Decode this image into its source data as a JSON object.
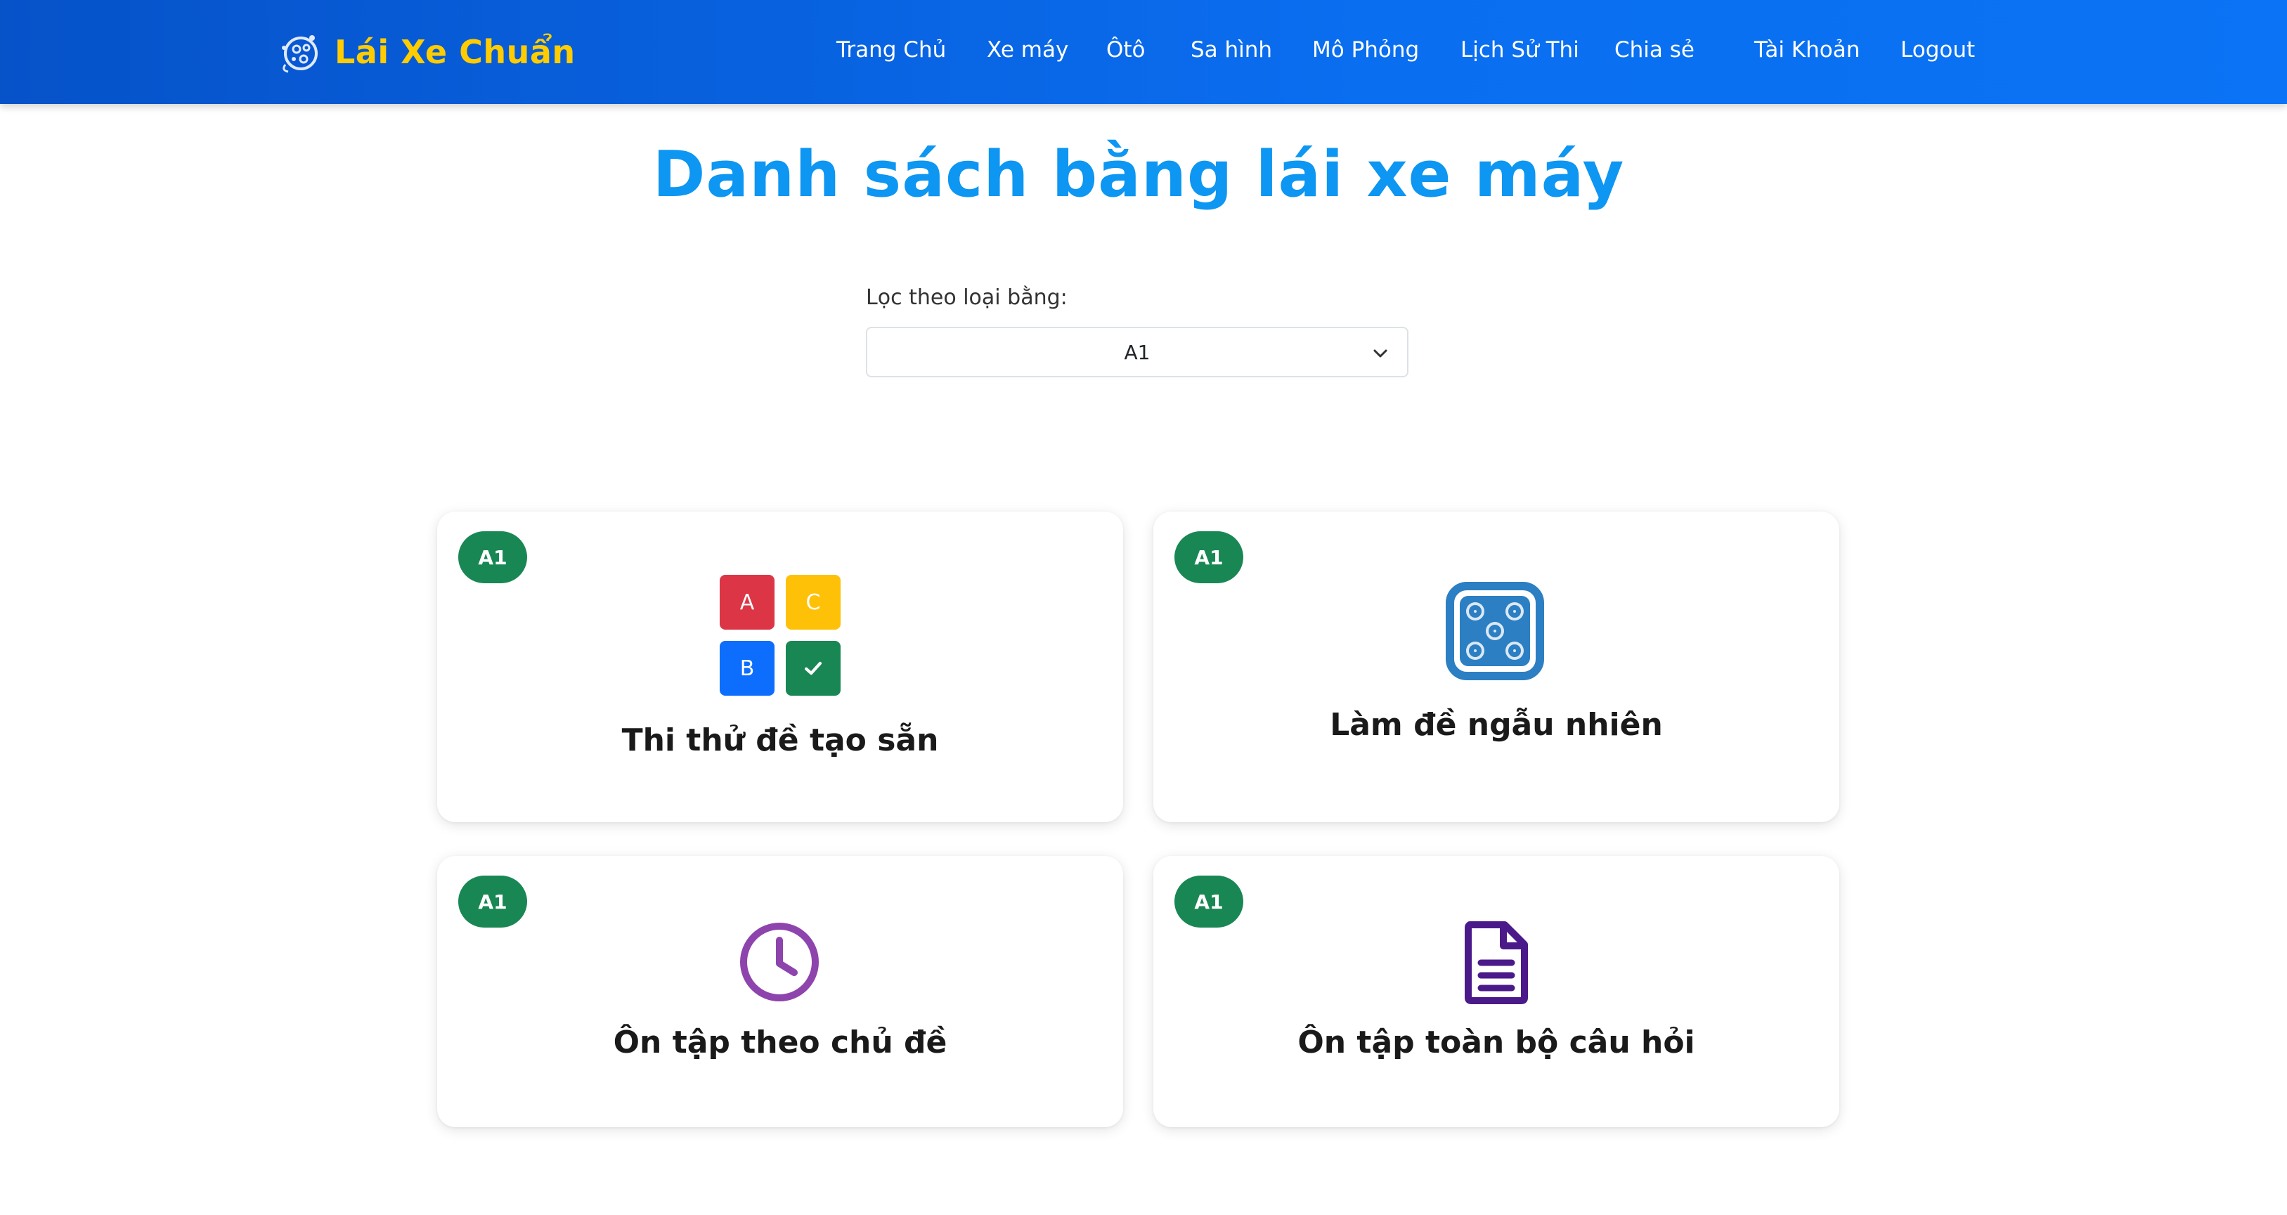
{
  "brand": {
    "name": "Lái Xe Chuẩn"
  },
  "nav": {
    "items": [
      {
        "label": "Trang Chủ"
      },
      {
        "label": "Xe máy"
      },
      {
        "label": "Ôtô"
      },
      {
        "label": "Sa hình"
      },
      {
        "label": "Mô Phỏng"
      },
      {
        "label": "Lịch Sử Thi"
      },
      {
        "label": "Chia sẻ"
      },
      {
        "label": "Tài Khoản"
      },
      {
        "label": "Logout"
      }
    ]
  },
  "page": {
    "title": "Danh sách bằng lái xe máy"
  },
  "filter": {
    "label": "Lọc theo loại bằng:",
    "value": "A1"
  },
  "cards": [
    {
      "badge": "A1",
      "title": "Thi thử đề tạo sẵn",
      "icon": "quiz-abc-icon"
    },
    {
      "badge": "A1",
      "title": "Làm đề ngẫu nhiên",
      "icon": "dice-icon"
    },
    {
      "badge": "A1",
      "title": "Ôn tập theo chủ đề",
      "icon": "clock-icon"
    },
    {
      "badge": "A1",
      "title": "Ôn tập toàn bộ câu hỏi",
      "icon": "document-icon"
    }
  ],
  "quiz_cells": [
    "A",
    "C",
    "B"
  ],
  "colors": {
    "nav_bg": "#0a6ef0",
    "brand": "#ffcc00",
    "title": "#0d96f2",
    "badge": "#198754",
    "cell_a": "#dc3545",
    "cell_c": "#ffc107",
    "cell_b": "#0d6efd",
    "cell_check": "#198754",
    "dice": "#2b7fc2",
    "clock": "#8e44ad",
    "document": "#4b1a8a"
  }
}
